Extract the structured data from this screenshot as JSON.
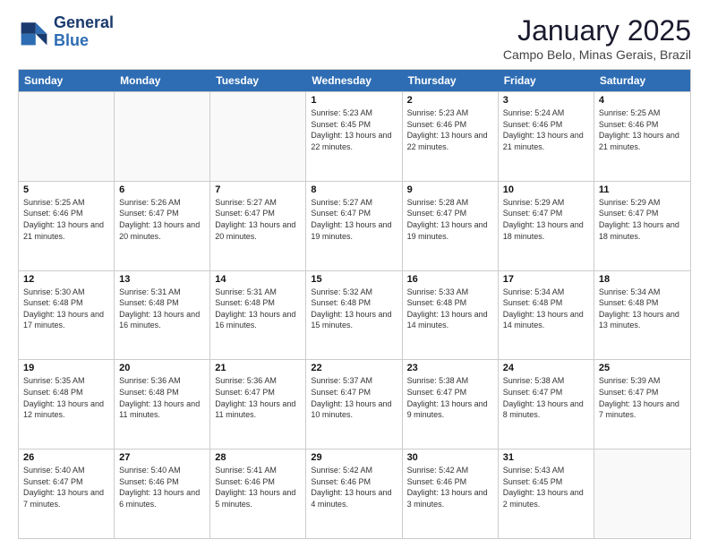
{
  "logo": {
    "line1": "General",
    "line2": "Blue"
  },
  "title": "January 2025",
  "location": "Campo Belo, Minas Gerais, Brazil",
  "weekdays": [
    "Sunday",
    "Monday",
    "Tuesday",
    "Wednesday",
    "Thursday",
    "Friday",
    "Saturday"
  ],
  "weeks": [
    [
      {
        "day": "",
        "info": ""
      },
      {
        "day": "",
        "info": ""
      },
      {
        "day": "",
        "info": ""
      },
      {
        "day": "1",
        "info": "Sunrise: 5:23 AM\nSunset: 6:45 PM\nDaylight: 13 hours and 22 minutes."
      },
      {
        "day": "2",
        "info": "Sunrise: 5:23 AM\nSunset: 6:46 PM\nDaylight: 13 hours and 22 minutes."
      },
      {
        "day": "3",
        "info": "Sunrise: 5:24 AM\nSunset: 6:46 PM\nDaylight: 13 hours and 21 minutes."
      },
      {
        "day": "4",
        "info": "Sunrise: 5:25 AM\nSunset: 6:46 PM\nDaylight: 13 hours and 21 minutes."
      }
    ],
    [
      {
        "day": "5",
        "info": "Sunrise: 5:25 AM\nSunset: 6:46 PM\nDaylight: 13 hours and 21 minutes."
      },
      {
        "day": "6",
        "info": "Sunrise: 5:26 AM\nSunset: 6:47 PM\nDaylight: 13 hours and 20 minutes."
      },
      {
        "day": "7",
        "info": "Sunrise: 5:27 AM\nSunset: 6:47 PM\nDaylight: 13 hours and 20 minutes."
      },
      {
        "day": "8",
        "info": "Sunrise: 5:27 AM\nSunset: 6:47 PM\nDaylight: 13 hours and 19 minutes."
      },
      {
        "day": "9",
        "info": "Sunrise: 5:28 AM\nSunset: 6:47 PM\nDaylight: 13 hours and 19 minutes."
      },
      {
        "day": "10",
        "info": "Sunrise: 5:29 AM\nSunset: 6:47 PM\nDaylight: 13 hours and 18 minutes."
      },
      {
        "day": "11",
        "info": "Sunrise: 5:29 AM\nSunset: 6:47 PM\nDaylight: 13 hours and 18 minutes."
      }
    ],
    [
      {
        "day": "12",
        "info": "Sunrise: 5:30 AM\nSunset: 6:48 PM\nDaylight: 13 hours and 17 minutes."
      },
      {
        "day": "13",
        "info": "Sunrise: 5:31 AM\nSunset: 6:48 PM\nDaylight: 13 hours and 16 minutes."
      },
      {
        "day": "14",
        "info": "Sunrise: 5:31 AM\nSunset: 6:48 PM\nDaylight: 13 hours and 16 minutes."
      },
      {
        "day": "15",
        "info": "Sunrise: 5:32 AM\nSunset: 6:48 PM\nDaylight: 13 hours and 15 minutes."
      },
      {
        "day": "16",
        "info": "Sunrise: 5:33 AM\nSunset: 6:48 PM\nDaylight: 13 hours and 14 minutes."
      },
      {
        "day": "17",
        "info": "Sunrise: 5:34 AM\nSunset: 6:48 PM\nDaylight: 13 hours and 14 minutes."
      },
      {
        "day": "18",
        "info": "Sunrise: 5:34 AM\nSunset: 6:48 PM\nDaylight: 13 hours and 13 minutes."
      }
    ],
    [
      {
        "day": "19",
        "info": "Sunrise: 5:35 AM\nSunset: 6:48 PM\nDaylight: 13 hours and 12 minutes."
      },
      {
        "day": "20",
        "info": "Sunrise: 5:36 AM\nSunset: 6:48 PM\nDaylight: 13 hours and 11 minutes."
      },
      {
        "day": "21",
        "info": "Sunrise: 5:36 AM\nSunset: 6:47 PM\nDaylight: 13 hours and 11 minutes."
      },
      {
        "day": "22",
        "info": "Sunrise: 5:37 AM\nSunset: 6:47 PM\nDaylight: 13 hours and 10 minutes."
      },
      {
        "day": "23",
        "info": "Sunrise: 5:38 AM\nSunset: 6:47 PM\nDaylight: 13 hours and 9 minutes."
      },
      {
        "day": "24",
        "info": "Sunrise: 5:38 AM\nSunset: 6:47 PM\nDaylight: 13 hours and 8 minutes."
      },
      {
        "day": "25",
        "info": "Sunrise: 5:39 AM\nSunset: 6:47 PM\nDaylight: 13 hours and 7 minutes."
      }
    ],
    [
      {
        "day": "26",
        "info": "Sunrise: 5:40 AM\nSunset: 6:47 PM\nDaylight: 13 hours and 7 minutes."
      },
      {
        "day": "27",
        "info": "Sunrise: 5:40 AM\nSunset: 6:46 PM\nDaylight: 13 hours and 6 minutes."
      },
      {
        "day": "28",
        "info": "Sunrise: 5:41 AM\nSunset: 6:46 PM\nDaylight: 13 hours and 5 minutes."
      },
      {
        "day": "29",
        "info": "Sunrise: 5:42 AM\nSunset: 6:46 PM\nDaylight: 13 hours and 4 minutes."
      },
      {
        "day": "30",
        "info": "Sunrise: 5:42 AM\nSunset: 6:46 PM\nDaylight: 13 hours and 3 minutes."
      },
      {
        "day": "31",
        "info": "Sunrise: 5:43 AM\nSunset: 6:45 PM\nDaylight: 13 hours and 2 minutes."
      },
      {
        "day": "",
        "info": ""
      }
    ]
  ]
}
